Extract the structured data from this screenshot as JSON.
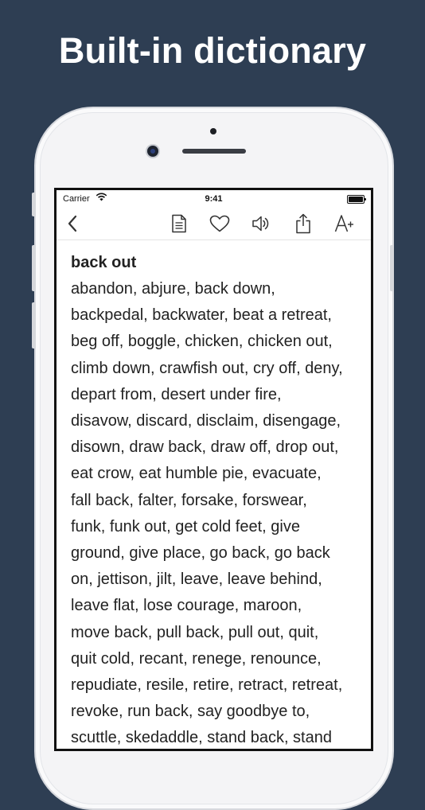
{
  "headline": "Built-in dictionary",
  "status_bar": {
    "carrier": "Carrier",
    "time": "9:41"
  },
  "toolbar": {
    "icons": [
      "chevron-left-icon",
      "document-icon",
      "heart-icon",
      "speaker-icon",
      "share-icon",
      "font-size-icon"
    ]
  },
  "entry": {
    "term": "back out",
    "lines": [
      "abandon, abjure, back down,",
      "backpedal, backwater, beat a retreat,",
      "beg off, boggle, chicken, chicken out,",
      "climb down, crawfish out, cry off, deny,",
      "depart from, desert under fire,",
      "disavow, discard, disclaim, disengage,",
      "disown, draw back, draw off, drop out,",
      "eat crow, eat humble pie, evacuate,",
      "fall back, falter, forsake, forswear,",
      "funk, funk out, get cold feet, give",
      "ground, give place, go back, go back",
      "on, jettison, jilt, leave, leave behind,",
      "leave flat, lose courage, maroon,",
      "move back, pull back, pull out, quit,",
      "quit cold, recant, renege, renounce,",
      "repudiate, resile, retire, retract, retreat,",
      "revoke, run back, say goodbye to,",
      "scuttle, skedaddle, stand back, stand"
    ]
  },
  "colors": {
    "background": "#2e3e53",
    "text": "#222222",
    "icon": "#333333"
  }
}
